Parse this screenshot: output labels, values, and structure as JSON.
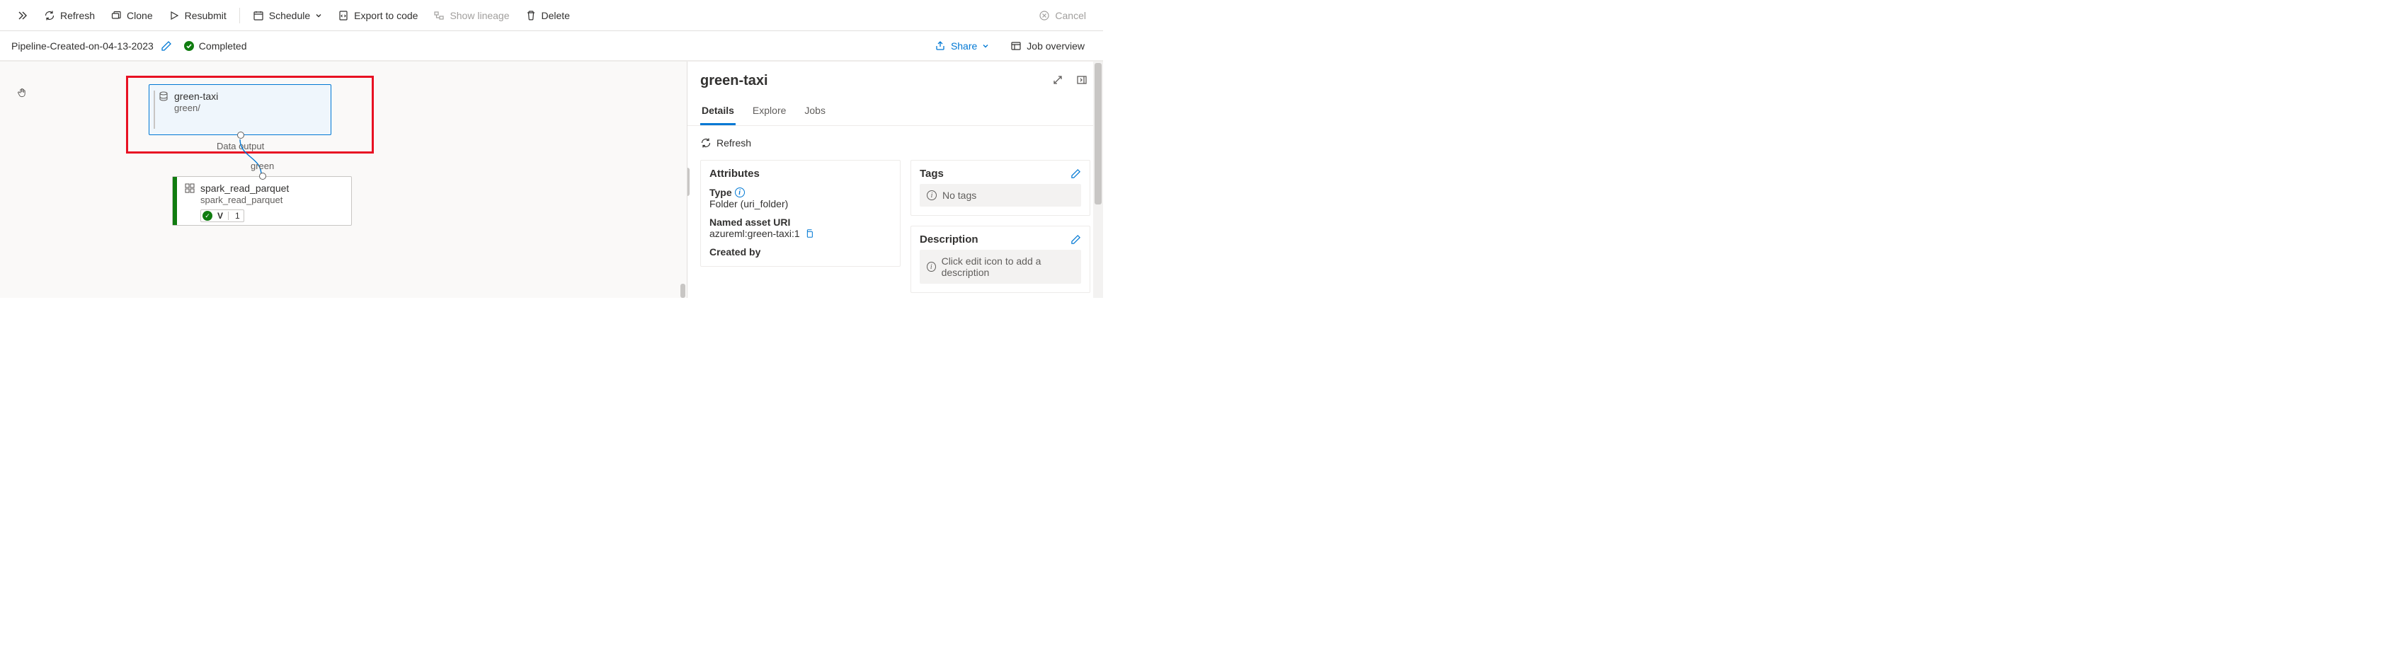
{
  "toolbar": {
    "refresh": "Refresh",
    "clone": "Clone",
    "resubmit": "Resubmit",
    "schedule": "Schedule",
    "export": "Export to code",
    "lineage": "Show lineage",
    "delete": "Delete",
    "cancel": "Cancel"
  },
  "subheader": {
    "pipeline_name": "Pipeline-Created-on-04-13-2023",
    "status": "Completed",
    "share": "Share",
    "overview": "Job overview"
  },
  "canvas": {
    "node_green": {
      "title": "green-taxi",
      "subtitle": "green/",
      "port_label": "Data output"
    },
    "edge_label": "green",
    "node_spark": {
      "title": "spark_read_parquet",
      "subtitle": "spark_read_parquet",
      "v_label": "V",
      "v_count": "1"
    }
  },
  "panel": {
    "title": "green-taxi",
    "tabs": {
      "details": "Details",
      "explore": "Explore",
      "jobs": "Jobs"
    },
    "refresh": "Refresh",
    "attributes": {
      "header": "Attributes",
      "type_label": "Type",
      "type_value": "Folder (uri_folder)",
      "uri_label": "Named asset URI",
      "uri_value": "azureml:green-taxi:1",
      "created_by_label": "Created by"
    },
    "tags": {
      "header": "Tags",
      "empty": "No tags"
    },
    "description": {
      "header": "Description",
      "empty": "Click edit icon to add a description"
    }
  }
}
